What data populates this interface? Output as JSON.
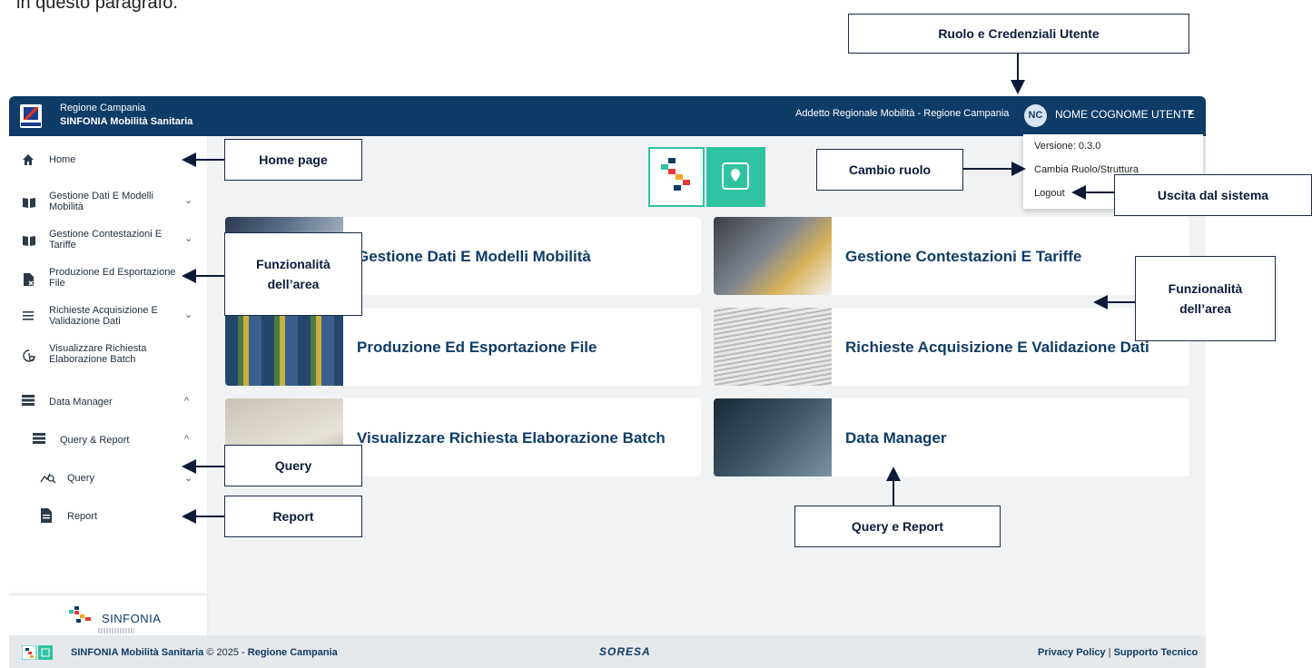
{
  "doc_fragment": "in questo paragrafo.",
  "topbar": {
    "brand_line1": "Regione Campania",
    "brand_line2": "SINFONIA Mobilità Sanitaria",
    "role_text": "Addetto Regionale Mobilità - Regione Campania",
    "avatar_initials": "NC",
    "user_name": "NOME COGNOME UTENTE"
  },
  "user_menu": {
    "items": [
      {
        "label": "Versione: 0.3.0"
      },
      {
        "label": "Cambia Ruolo/Struttura"
      },
      {
        "label": "Logout"
      }
    ]
  },
  "sidebar": {
    "items": [
      {
        "label": "Home",
        "icon": "home-icon",
        "caret": ""
      },
      {
        "label": "Gestione Dati E Modelli Mobilità",
        "icon": "book-icon",
        "caret": "⌄"
      },
      {
        "label": "Gestione Contestazioni E Tariffe",
        "icon": "book-icon",
        "caret": "⌄"
      },
      {
        "label": "Produzione Ed Esportazione File",
        "icon": "file-export-icon",
        "caret": ""
      },
      {
        "label": "Richieste Acquisizione E Validazione Dati",
        "icon": "list-icon",
        "caret": "⌄"
      },
      {
        "label": "Visualizzare Richiesta Elaborazione Batch",
        "icon": "history-gear-icon",
        "caret": ""
      },
      {
        "label": "Data Manager",
        "icon": "database-icon",
        "caret": "^"
      },
      {
        "label": "Query & Report",
        "icon": "database-icon",
        "caret": "^"
      },
      {
        "label": "Query",
        "icon": "query-chart-icon",
        "caret": "⌄"
      },
      {
        "label": "Report",
        "icon": "report-icon",
        "caret": "⌄"
      }
    ],
    "footer_brand": "SINFONIA"
  },
  "cards": [
    {
      "title": "Gestione Dati E Modelli Mobilità"
    },
    {
      "title": "Gestione Contestazioni E Tariffe"
    },
    {
      "title": "Produzione Ed Esportazione File"
    },
    {
      "title": "Richieste Acquisizione E Validazione Dati"
    },
    {
      "title": "Visualizzare Richiesta Elaborazione Batch"
    },
    {
      "title": "Data Manager"
    }
  ],
  "footer": {
    "app_name": "SINFONIA Mobilità Sanitaria",
    "copyright": "© 2025 -",
    "org": "Regione Campania",
    "partner_logo": "SORESA",
    "privacy": "Privacy Policy",
    "separator": "|",
    "support": "Supporto Tecnico"
  },
  "callouts": {
    "ruolo": "Ruolo e Credenziali Utente",
    "home": "Home page",
    "cambio": "Cambio ruolo",
    "uscita": "Uscita dal sistema",
    "funz_left_1": "Funzionalità",
    "funz_left_2": "dell’area",
    "funz_right_1": "Funzionalità",
    "funz_right_2": "dell’area",
    "query": "Query",
    "report": "Report",
    "query_report": "Query e Report"
  },
  "colors": {
    "topbar": "#0f3c67",
    "accent": "#2fc3a2",
    "background": "#f0f2f4"
  }
}
